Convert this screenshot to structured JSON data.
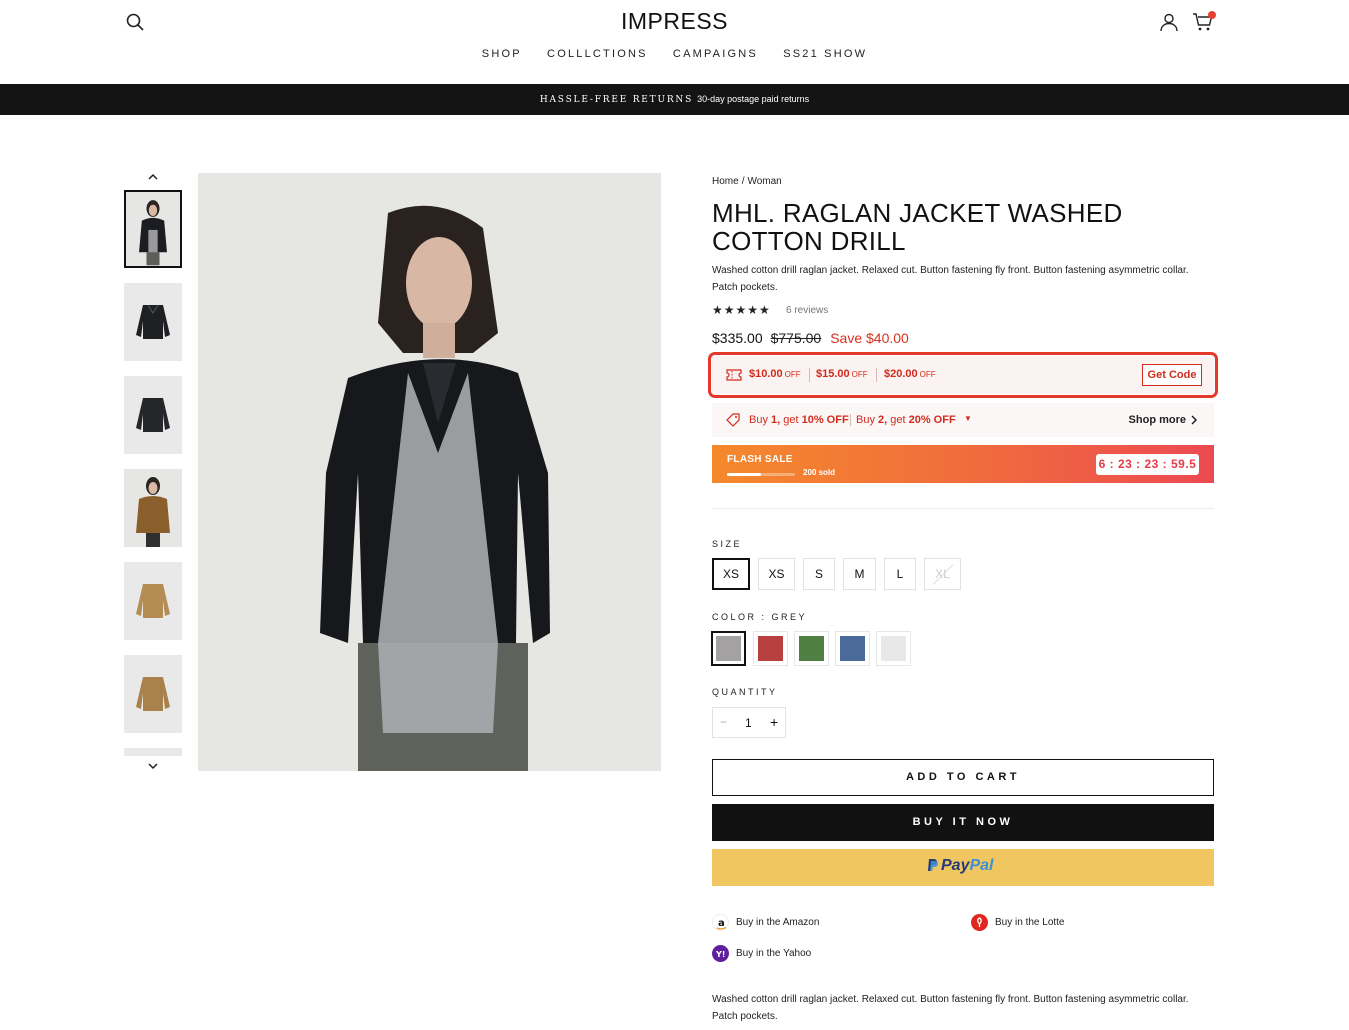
{
  "header": {
    "logo": "IMPRESS",
    "nav": [
      "SHOP",
      "COLLLCTIONS",
      "CAMPAIGNS",
      "SS21 SHOW"
    ]
  },
  "announcement": {
    "strong": "HASSLE-FREE RETURNS",
    "text": "30-day postage paid returns"
  },
  "breadcrumb": {
    "home": "Home",
    "sep": "/",
    "current": "Woman"
  },
  "product": {
    "title": "MHL. RAGLAN JACKET WASHED COTTON DRILL",
    "description": "Washed cotton drill raglan jacket. Relaxed cut. Button fastening fly front. Button fastening asymmetric collar. Patch pockets.",
    "rating_stars": "★★★★★",
    "rating_value": 4.5,
    "reviews": "6 reviews",
    "price": "$335.00",
    "compare_price": "$775.00",
    "save": "Save $40.00"
  },
  "coupons": {
    "items": [
      {
        "amount": "$10.00",
        "suffix": "OFF"
      },
      {
        "amount": "$15.00",
        "suffix": "OFF"
      },
      {
        "amount": "$20.00",
        "suffix": "OFF"
      }
    ],
    "get_code": "Get Code"
  },
  "bundle": {
    "offer1_pre": "Buy ",
    "offer1_bold": "1,",
    "offer1_mid": " get ",
    "offer1_pct": "10% OFF",
    "offer2_pre": "Buy ",
    "offer2_bold": "2,",
    "offer2_mid": " get ",
    "offer2_pct": "20% OFF",
    "shop_more": "Shop more"
  },
  "flash": {
    "label": "FLASH SALE",
    "sold": "200 sold",
    "timer": "6 : 23 : 23 : 59.5",
    "progress": 0.5
  },
  "size": {
    "label": "SIZE",
    "options": [
      "XS",
      "XS",
      "S",
      "M",
      "L",
      "XL"
    ]
  },
  "color": {
    "label": "COLOR : GREY",
    "swatches": [
      "#a3a1a2",
      "#b8403e",
      "#4f7f42",
      "#4a6b9a",
      "#e8e8e8"
    ]
  },
  "quantity": {
    "label": "QUANTITY",
    "minus": "−",
    "value": "1",
    "plus": "+"
  },
  "buttons": {
    "add": "ADD TO CART",
    "buy": "BUY IT NOW",
    "paypal_a": "Pay",
    "paypal_b": "Pal"
  },
  "buy_in": {
    "amazon": "Buy in the Amazon",
    "lotte": "Buy in the Lotte",
    "yahoo": "Buy in the Yahoo"
  },
  "colors": {
    "accent_red": "#d22b1d",
    "flash_start": "#f5892c",
    "flash_end": "#ec4a52",
    "paypal": "#f0c660"
  }
}
